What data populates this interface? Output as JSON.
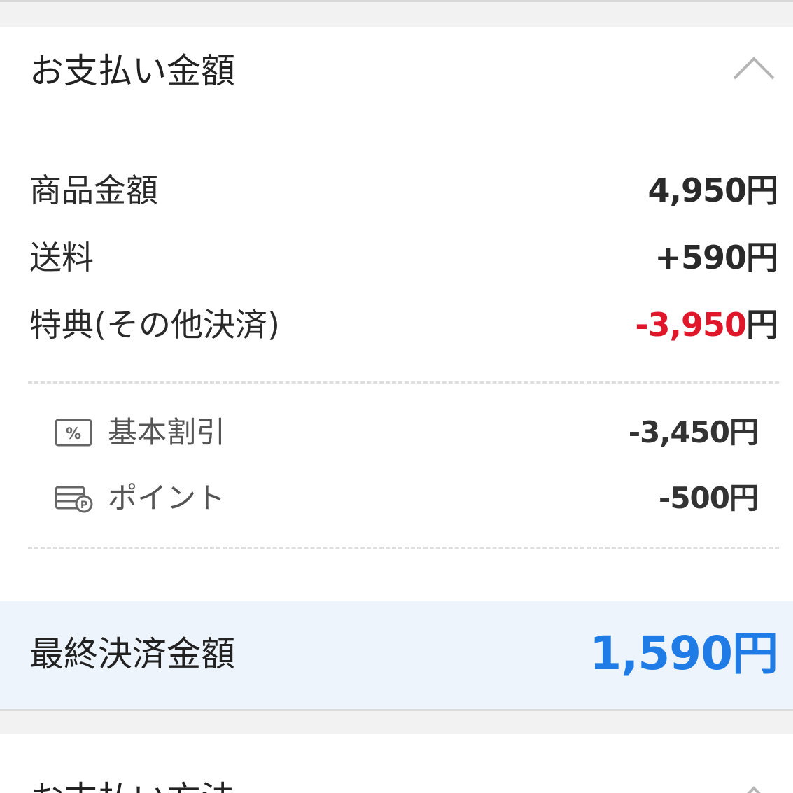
{
  "payment_summary": {
    "title": "お支払い金額",
    "rows": [
      {
        "label": "商品金額",
        "value": "4,950円"
      },
      {
        "label": "送料",
        "value": "+590円"
      },
      {
        "label": "特典(その他決済)",
        "value_amount": "-3,950",
        "value_unit": "円"
      }
    ],
    "breakdown": [
      {
        "icon": "discount-percent-icon",
        "label": "基本割引",
        "value": "-3,450円"
      },
      {
        "icon": "point-card-icon",
        "label": "ポイント",
        "value": "-500円"
      }
    ],
    "total": {
      "label": "最終決済金額",
      "value": "1,590円"
    }
  },
  "payment_method": {
    "title": "お支払い方法"
  },
  "colors": {
    "negative": "#e0162b",
    "total_accent": "#1f7be6",
    "total_bg": "#eef4fb"
  }
}
